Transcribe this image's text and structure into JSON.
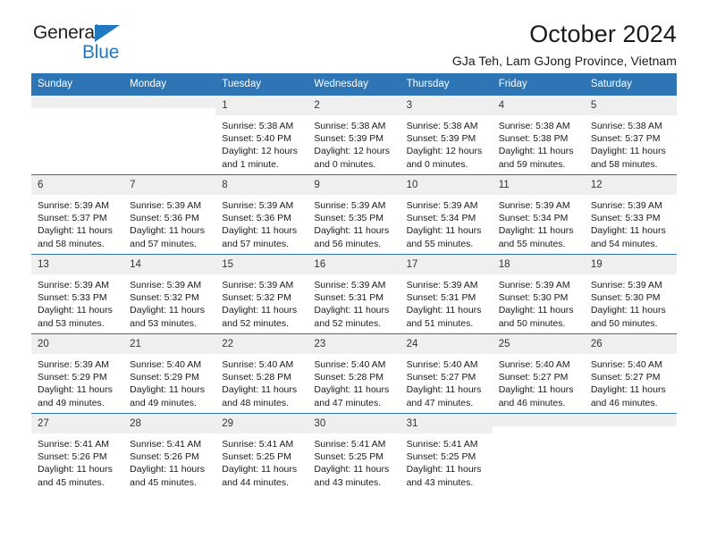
{
  "brand": {
    "name_part1": "General",
    "name_part2": "Blue",
    "logo_icon": "triangle-logo-icon"
  },
  "header": {
    "title": "October 2024",
    "subtitle": "GJa Teh, Lam GJong Province, Vietnam",
    "accent_color": "#2e75b6",
    "brand_blue": "#1f78c1"
  },
  "calendar": {
    "weekday_headers": [
      "Sunday",
      "Monday",
      "Tuesday",
      "Wednesday",
      "Thursday",
      "Friday",
      "Saturday"
    ],
    "labels": {
      "sunrise": "Sunrise:",
      "sunset": "Sunset:",
      "daylight": "Daylight:"
    },
    "weeks": [
      [
        {
          "day": "",
          "empty": true
        },
        {
          "day": "",
          "empty": true
        },
        {
          "day": "1",
          "sunrise": "Sunrise: 5:38 AM",
          "sunset": "Sunset: 5:40 PM",
          "daylight_l1": "Daylight: 12 hours",
          "daylight_l2": "and 1 minute."
        },
        {
          "day": "2",
          "sunrise": "Sunrise: 5:38 AM",
          "sunset": "Sunset: 5:39 PM",
          "daylight_l1": "Daylight: 12 hours",
          "daylight_l2": "and 0 minutes."
        },
        {
          "day": "3",
          "sunrise": "Sunrise: 5:38 AM",
          "sunset": "Sunset: 5:39 PM",
          "daylight_l1": "Daylight: 12 hours",
          "daylight_l2": "and 0 minutes."
        },
        {
          "day": "4",
          "sunrise": "Sunrise: 5:38 AM",
          "sunset": "Sunset: 5:38 PM",
          "daylight_l1": "Daylight: 11 hours",
          "daylight_l2": "and 59 minutes."
        },
        {
          "day": "5",
          "sunrise": "Sunrise: 5:38 AM",
          "sunset": "Sunset: 5:37 PM",
          "daylight_l1": "Daylight: 11 hours",
          "daylight_l2": "and 58 minutes."
        }
      ],
      [
        {
          "day": "6",
          "sunrise": "Sunrise: 5:39 AM",
          "sunset": "Sunset: 5:37 PM",
          "daylight_l1": "Daylight: 11 hours",
          "daylight_l2": "and 58 minutes."
        },
        {
          "day": "7",
          "sunrise": "Sunrise: 5:39 AM",
          "sunset": "Sunset: 5:36 PM",
          "daylight_l1": "Daylight: 11 hours",
          "daylight_l2": "and 57 minutes."
        },
        {
          "day": "8",
          "sunrise": "Sunrise: 5:39 AM",
          "sunset": "Sunset: 5:36 PM",
          "daylight_l1": "Daylight: 11 hours",
          "daylight_l2": "and 57 minutes."
        },
        {
          "day": "9",
          "sunrise": "Sunrise: 5:39 AM",
          "sunset": "Sunset: 5:35 PM",
          "daylight_l1": "Daylight: 11 hours",
          "daylight_l2": "and 56 minutes."
        },
        {
          "day": "10",
          "sunrise": "Sunrise: 5:39 AM",
          "sunset": "Sunset: 5:34 PM",
          "daylight_l1": "Daylight: 11 hours",
          "daylight_l2": "and 55 minutes."
        },
        {
          "day": "11",
          "sunrise": "Sunrise: 5:39 AM",
          "sunset": "Sunset: 5:34 PM",
          "daylight_l1": "Daylight: 11 hours",
          "daylight_l2": "and 55 minutes."
        },
        {
          "day": "12",
          "sunrise": "Sunrise: 5:39 AM",
          "sunset": "Sunset: 5:33 PM",
          "daylight_l1": "Daylight: 11 hours",
          "daylight_l2": "and 54 minutes."
        }
      ],
      [
        {
          "day": "13",
          "sunrise": "Sunrise: 5:39 AM",
          "sunset": "Sunset: 5:33 PM",
          "daylight_l1": "Daylight: 11 hours",
          "daylight_l2": "and 53 minutes."
        },
        {
          "day": "14",
          "sunrise": "Sunrise: 5:39 AM",
          "sunset": "Sunset: 5:32 PM",
          "daylight_l1": "Daylight: 11 hours",
          "daylight_l2": "and 53 minutes."
        },
        {
          "day": "15",
          "sunrise": "Sunrise: 5:39 AM",
          "sunset": "Sunset: 5:32 PM",
          "daylight_l1": "Daylight: 11 hours",
          "daylight_l2": "and 52 minutes."
        },
        {
          "day": "16",
          "sunrise": "Sunrise: 5:39 AM",
          "sunset": "Sunset: 5:31 PM",
          "daylight_l1": "Daylight: 11 hours",
          "daylight_l2": "and 52 minutes."
        },
        {
          "day": "17",
          "sunrise": "Sunrise: 5:39 AM",
          "sunset": "Sunset: 5:31 PM",
          "daylight_l1": "Daylight: 11 hours",
          "daylight_l2": "and 51 minutes."
        },
        {
          "day": "18",
          "sunrise": "Sunrise: 5:39 AM",
          "sunset": "Sunset: 5:30 PM",
          "daylight_l1": "Daylight: 11 hours",
          "daylight_l2": "and 50 minutes."
        },
        {
          "day": "19",
          "sunrise": "Sunrise: 5:39 AM",
          "sunset": "Sunset: 5:30 PM",
          "daylight_l1": "Daylight: 11 hours",
          "daylight_l2": "and 50 minutes."
        }
      ],
      [
        {
          "day": "20",
          "sunrise": "Sunrise: 5:39 AM",
          "sunset": "Sunset: 5:29 PM",
          "daylight_l1": "Daylight: 11 hours",
          "daylight_l2": "and 49 minutes."
        },
        {
          "day": "21",
          "sunrise": "Sunrise: 5:40 AM",
          "sunset": "Sunset: 5:29 PM",
          "daylight_l1": "Daylight: 11 hours",
          "daylight_l2": "and 49 minutes."
        },
        {
          "day": "22",
          "sunrise": "Sunrise: 5:40 AM",
          "sunset": "Sunset: 5:28 PM",
          "daylight_l1": "Daylight: 11 hours",
          "daylight_l2": "and 48 minutes."
        },
        {
          "day": "23",
          "sunrise": "Sunrise: 5:40 AM",
          "sunset": "Sunset: 5:28 PM",
          "daylight_l1": "Daylight: 11 hours",
          "daylight_l2": "and 47 minutes."
        },
        {
          "day": "24",
          "sunrise": "Sunrise: 5:40 AM",
          "sunset": "Sunset: 5:27 PM",
          "daylight_l1": "Daylight: 11 hours",
          "daylight_l2": "and 47 minutes."
        },
        {
          "day": "25",
          "sunrise": "Sunrise: 5:40 AM",
          "sunset": "Sunset: 5:27 PM",
          "daylight_l1": "Daylight: 11 hours",
          "daylight_l2": "and 46 minutes."
        },
        {
          "day": "26",
          "sunrise": "Sunrise: 5:40 AM",
          "sunset": "Sunset: 5:27 PM",
          "daylight_l1": "Daylight: 11 hours",
          "daylight_l2": "and 46 minutes."
        }
      ],
      [
        {
          "day": "27",
          "sunrise": "Sunrise: 5:41 AM",
          "sunset": "Sunset: 5:26 PM",
          "daylight_l1": "Daylight: 11 hours",
          "daylight_l2": "and 45 minutes."
        },
        {
          "day": "28",
          "sunrise": "Sunrise: 5:41 AM",
          "sunset": "Sunset: 5:26 PM",
          "daylight_l1": "Daylight: 11 hours",
          "daylight_l2": "and 45 minutes."
        },
        {
          "day": "29",
          "sunrise": "Sunrise: 5:41 AM",
          "sunset": "Sunset: 5:25 PM",
          "daylight_l1": "Daylight: 11 hours",
          "daylight_l2": "and 44 minutes."
        },
        {
          "day": "30",
          "sunrise": "Sunrise: 5:41 AM",
          "sunset": "Sunset: 5:25 PM",
          "daylight_l1": "Daylight: 11 hours",
          "daylight_l2": "and 43 minutes."
        },
        {
          "day": "31",
          "sunrise": "Sunrise: 5:41 AM",
          "sunset": "Sunset: 5:25 PM",
          "daylight_l1": "Daylight: 11 hours",
          "daylight_l2": "and 43 minutes."
        },
        {
          "day": "",
          "empty": true
        },
        {
          "day": "",
          "empty": true
        }
      ]
    ]
  }
}
